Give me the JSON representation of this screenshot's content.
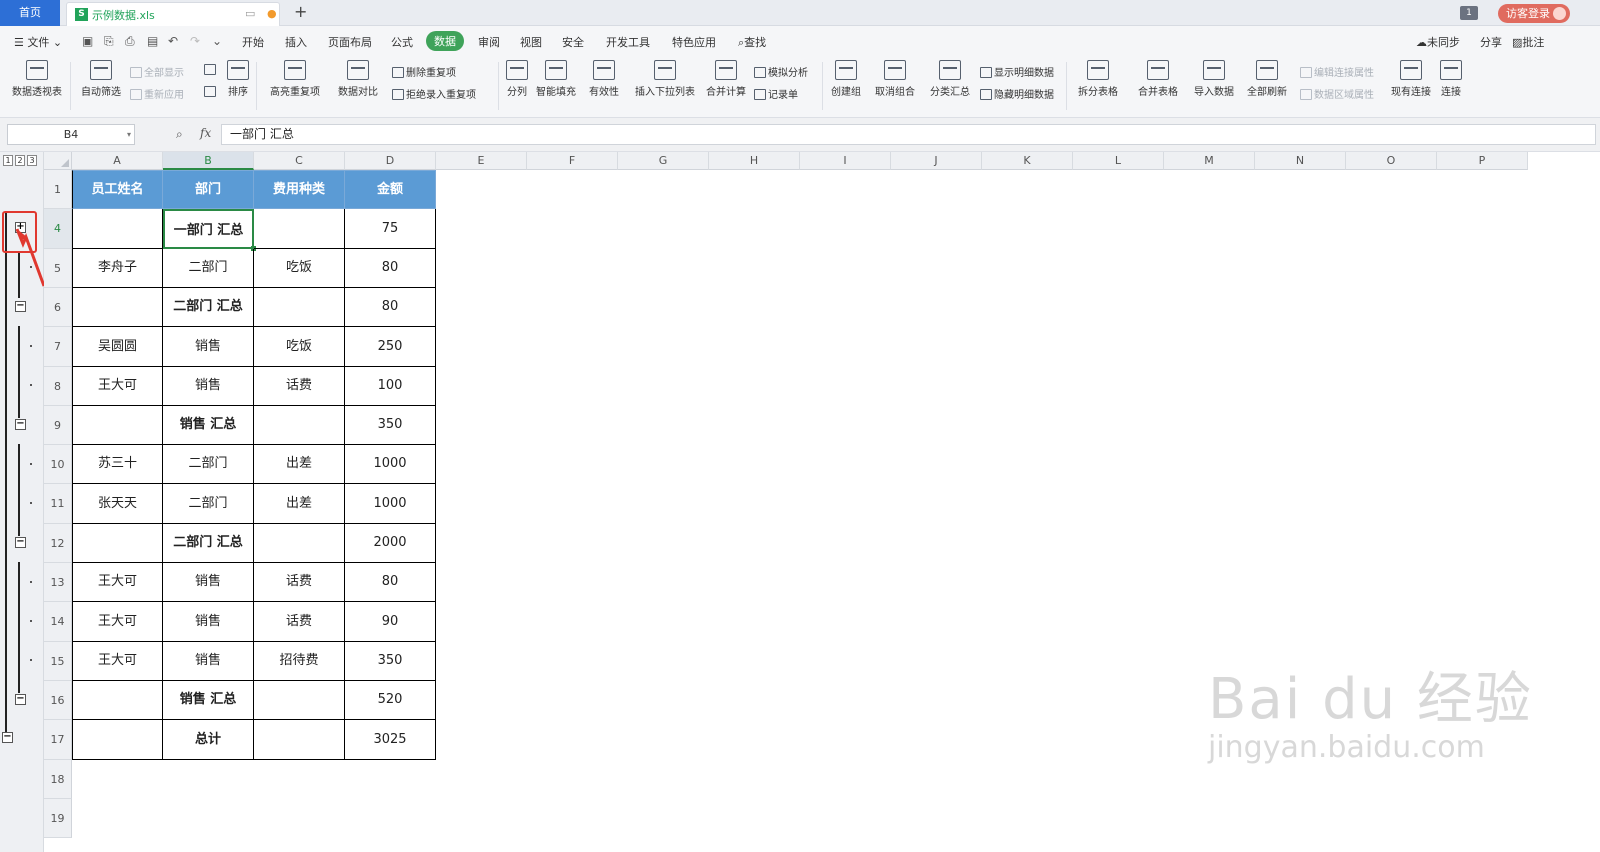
{
  "tabs": {
    "home": "首页",
    "file": "示例数据.xls",
    "xls_badge": "S",
    "pin": "▭",
    "dot": "●",
    "add": "+"
  },
  "titlebar": {
    "win_count": "1",
    "guest_login": "访客登录"
  },
  "menu": {
    "file": "☰ 文件 ⌄",
    "items": [
      "开始",
      "插入",
      "页面布局",
      "公式",
      "数据",
      "审阅",
      "视图",
      "安全",
      "开发工具",
      "特色应用"
    ],
    "active": "数据",
    "search": "查找",
    "sync": "未同步",
    "share": "分享",
    "comment": "批注"
  },
  "ribbon": {
    "pivot": "数据透视表",
    "autofilter": "自动筛选",
    "show_all": "全部显示",
    "reapply": "重新应用",
    "sort": "排序",
    "highlight_dup": "高亮重复项",
    "compare": "数据对比",
    "delete_dup": "删除重复项",
    "reject_dup": "拒绝录入重复项",
    "split_col": "分列",
    "smart_fill": "智能填充",
    "validity": "有效性",
    "insert_dropdown": "插入下拉列表",
    "consolidate": "合并计算",
    "simulate": "模拟分析",
    "record": "记录单",
    "group": "创建组",
    "ungroup": "取消组合",
    "subtotal": "分类汇总",
    "show_detail": "显示明细数据",
    "hide_detail": "隐藏明细数据",
    "split_table": "拆分表格",
    "merge_table": "合并表格",
    "import": "导入数据",
    "refresh_all": "全部刷新",
    "edit_conn": "编辑连接属性",
    "area_attr": "数据区域属性",
    "existing_conn": "现有连接",
    "connect": "连接"
  },
  "formula_bar": {
    "name_box": "B4",
    "fx": "fx",
    "formula": "一部门 汇总"
  },
  "outline": {
    "levels": [
      "1",
      "2",
      "3"
    ],
    "collapsed": "+",
    "expanded": "−"
  },
  "columns": [
    "A",
    "B",
    "C",
    "D",
    "E",
    "F",
    "G",
    "H",
    "I",
    "J",
    "K",
    "L",
    "M",
    "N",
    "O",
    "P"
  ],
  "rows": [
    {
      "num": "1",
      "cells": [
        "员工姓名",
        "部门",
        "费用种类",
        "金额"
      ]
    },
    {
      "num": "4",
      "cells": [
        "",
        "一部门 汇总",
        "",
        "75"
      ]
    },
    {
      "num": "5",
      "cells": [
        "李舟子",
        "二部门",
        "吃饭",
        "80"
      ]
    },
    {
      "num": "6",
      "cells": [
        "",
        "二部门 汇总",
        "",
        "80"
      ]
    },
    {
      "num": "7",
      "cells": [
        "吴圆圆",
        "销售",
        "吃饭",
        "250"
      ]
    },
    {
      "num": "8",
      "cells": [
        "王大可",
        "销售",
        "话费",
        "100"
      ]
    },
    {
      "num": "9",
      "cells": [
        "",
        "销售 汇总",
        "",
        "350"
      ]
    },
    {
      "num": "10",
      "cells": [
        "苏三十",
        "二部门",
        "出差",
        "1000"
      ]
    },
    {
      "num": "11",
      "cells": [
        "张天天",
        "二部门",
        "出差",
        "1000"
      ]
    },
    {
      "num": "12",
      "cells": [
        "",
        "二部门 汇总",
        "",
        "2000"
      ]
    },
    {
      "num": "13",
      "cells": [
        "王大可",
        "销售",
        "话费",
        "80"
      ]
    },
    {
      "num": "14",
      "cells": [
        "王大可",
        "销售",
        "话费",
        "90"
      ]
    },
    {
      "num": "15",
      "cells": [
        "王大可",
        "销售",
        "招待费",
        "350"
      ]
    },
    {
      "num": "16",
      "cells": [
        "",
        "销售 汇总",
        "",
        "520"
      ]
    },
    {
      "num": "17",
      "cells": [
        "",
        "总计",
        "",
        "3025"
      ]
    },
    {
      "num": "18",
      "cells": [
        "",
        "",
        "",
        ""
      ]
    },
    {
      "num": "19",
      "cells": [
        "",
        "",
        "",
        ""
      ]
    }
  ],
  "watermark": {
    "line1": "Bai du 经验",
    "line2": "jingyan.baidu.com"
  }
}
